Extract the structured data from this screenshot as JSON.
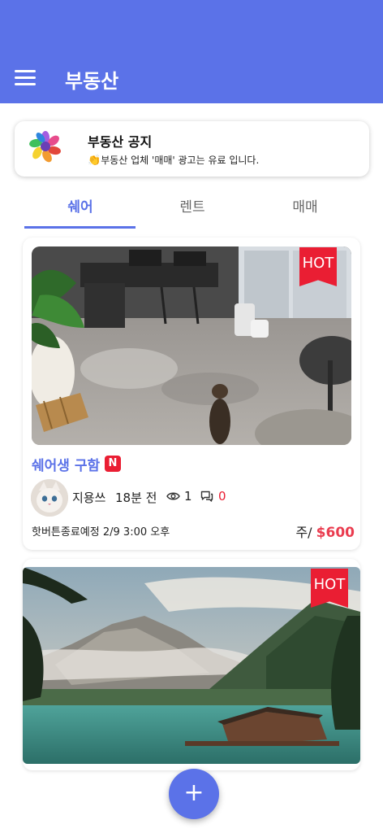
{
  "app": {
    "title": "부동산"
  },
  "notice": {
    "title": "부동산 공지",
    "hand_icon": "clap-hands-icon",
    "subtitle": "부동산 업체 '매매' 광고는 유료 입니다."
  },
  "tabs": [
    {
      "label": "쉐어",
      "active": true
    },
    {
      "label": "렌트",
      "active": false
    },
    {
      "label": "매매",
      "active": false
    }
  ],
  "posts": [
    {
      "badge": "HOT",
      "title": "쉐어생 구함",
      "new_badge": "N",
      "author": "지용쓰",
      "time": "18분 전",
      "views": "1",
      "comments": "0",
      "expiry_label": "핫버튼종료예정",
      "expiry_value": "2/9 3:00 오후",
      "price_period": "주/",
      "price": "$600"
    },
    {
      "badge": "HOT"
    }
  ],
  "fab": {
    "label": "+"
  },
  "colors": {
    "primary": "#5b72e8",
    "hot": "#ea1e33",
    "price": "#ea3c4f"
  }
}
